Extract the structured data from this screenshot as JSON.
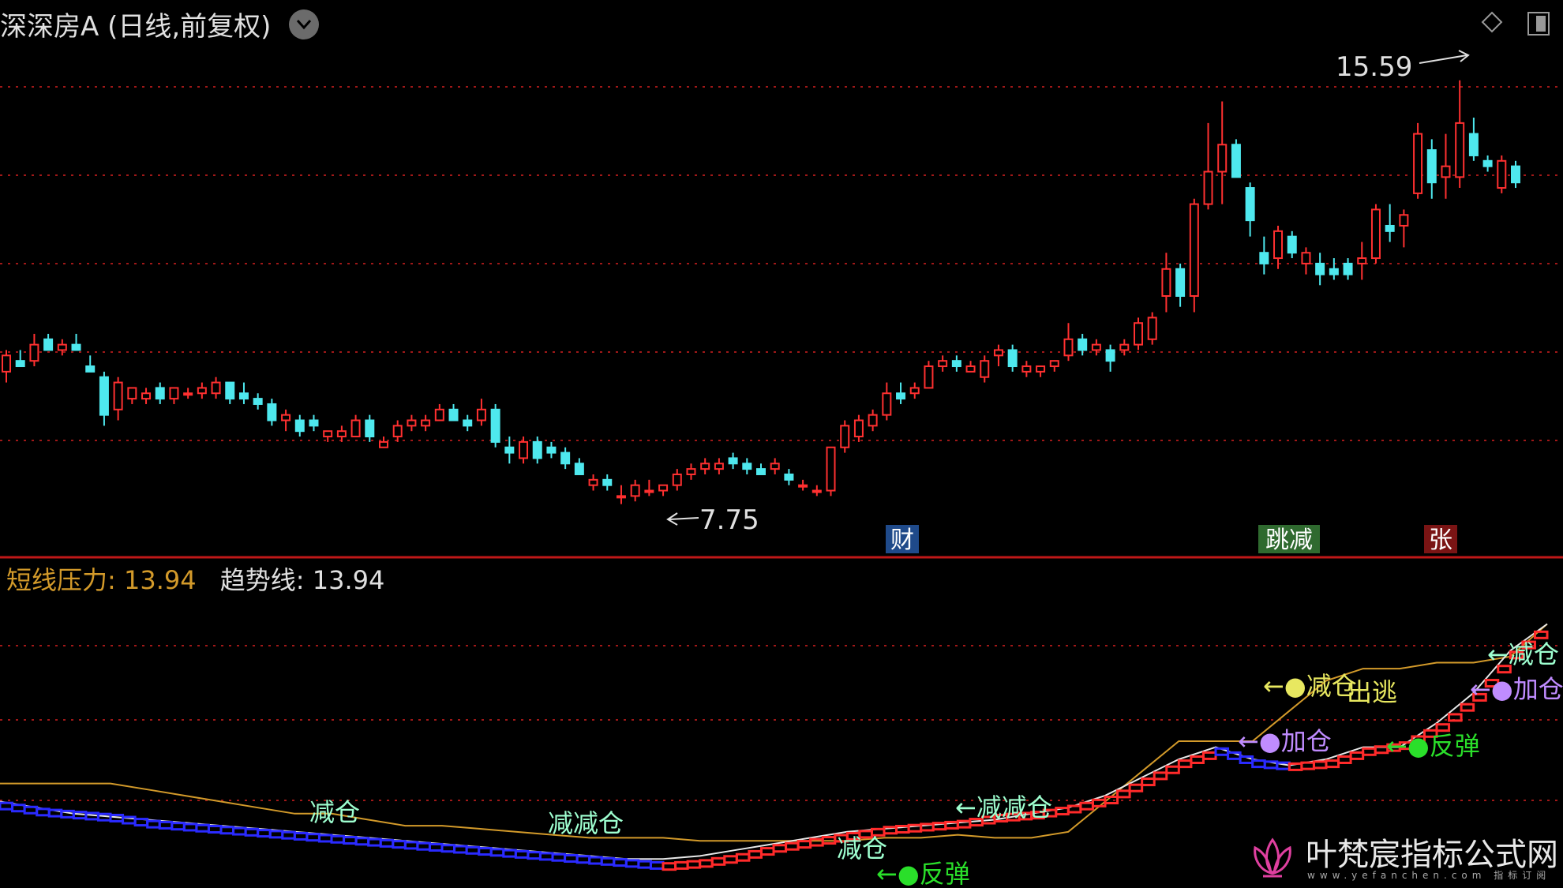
{
  "header": {
    "title": "深深房A (日线,前复权)"
  },
  "markers": {
    "high_label": "15.59",
    "low_label": "7.75",
    "badge_cai": "财",
    "badge_jianjian": "跳减",
    "badge_zhang": "张"
  },
  "legend": {
    "label1": "短线压力:",
    "value1": "13.94",
    "label2": "趋势线:",
    "value2": "13.94"
  },
  "signals": {
    "s1": "减仓",
    "s2": "减减仓",
    "s3": "减仓",
    "s4": "←●反弹",
    "s5": "←减减仓",
    "s6": "←●减仓",
    "s7": "出逃",
    "s8": "←●加仓",
    "s9": "←●反弹",
    "s10": "←减仓",
    "s11": "←●加仓"
  },
  "watermark": {
    "text": "叶梵宸指标公式网",
    "sub": "www.yefanchen.com  指标订阅"
  },
  "colors": {
    "up": "#ff3030",
    "down": "#4ee8ee",
    "grid": "#a01818",
    "orange": "#d39a2a",
    "white_line": "#e8e8e8",
    "blue": "#2a2aff",
    "red_band": "#ff2a2a",
    "green_text": "#2adf2a",
    "yellow_text": "#e8e860",
    "magenta": "#e040e0",
    "violet_text": "#c08cff",
    "cyan_text": "#9effd0"
  },
  "chart_data": [
    {
      "type": "candlestick",
      "ylim": [
        7.0,
        16.2
      ],
      "high_marker": 15.59,
      "low_marker": 7.75,
      "candles": [
        [
          10.2,
          10.6,
          10.0,
          10.5
        ],
        [
          10.4,
          10.6,
          10.3,
          10.3
        ],
        [
          10.4,
          10.9,
          10.3,
          10.7
        ],
        [
          10.8,
          10.9,
          10.6,
          10.6
        ],
        [
          10.6,
          10.8,
          10.5,
          10.7
        ],
        [
          10.7,
          10.9,
          10.6,
          10.6
        ],
        [
          10.3,
          10.5,
          10.2,
          10.2
        ],
        [
          10.1,
          10.2,
          9.2,
          9.4
        ],
        [
          9.5,
          10.1,
          9.3,
          10.0
        ],
        [
          9.7,
          9.9,
          9.6,
          9.9
        ],
        [
          9.7,
          9.9,
          9.6,
          9.8
        ],
        [
          9.9,
          10.0,
          9.6,
          9.7
        ],
        [
          9.7,
          9.9,
          9.6,
          9.9
        ],
        [
          9.8,
          9.9,
          9.7,
          9.8
        ],
        [
          9.8,
          10.0,
          9.7,
          9.9
        ],
        [
          9.8,
          10.1,
          9.7,
          10.0
        ],
        [
          10.0,
          10.0,
          9.6,
          9.7
        ],
        [
          9.8,
          10.0,
          9.6,
          9.7
        ],
        [
          9.7,
          9.8,
          9.5,
          9.6
        ],
        [
          9.6,
          9.7,
          9.2,
          9.3
        ],
        [
          9.3,
          9.5,
          9.1,
          9.4
        ],
        [
          9.3,
          9.4,
          9.0,
          9.1
        ],
        [
          9.3,
          9.4,
          9.1,
          9.2
        ],
        [
          9.0,
          9.1,
          8.9,
          9.1
        ],
        [
          9.0,
          9.2,
          8.9,
          9.1
        ],
        [
          9.0,
          9.4,
          9.0,
          9.3
        ],
        [
          9.3,
          9.4,
          8.9,
          9.0
        ],
        [
          8.8,
          9.0,
          8.8,
          8.9
        ],
        [
          9.0,
          9.3,
          8.9,
          9.2
        ],
        [
          9.2,
          9.4,
          9.1,
          9.3
        ],
        [
          9.2,
          9.4,
          9.1,
          9.3
        ],
        [
          9.3,
          9.6,
          9.3,
          9.5
        ],
        [
          9.5,
          9.6,
          9.3,
          9.3
        ],
        [
          9.3,
          9.4,
          9.1,
          9.2
        ],
        [
          9.3,
          9.7,
          9.2,
          9.5
        ],
        [
          9.5,
          9.6,
          8.8,
          8.9
        ],
        [
          8.8,
          9.0,
          8.5,
          8.7
        ],
        [
          8.6,
          9.0,
          8.5,
          8.9
        ],
        [
          8.9,
          9.0,
          8.5,
          8.6
        ],
        [
          8.8,
          8.9,
          8.6,
          8.7
        ],
        [
          8.7,
          8.8,
          8.4,
          8.5
        ],
        [
          8.5,
          8.6,
          8.3,
          8.3
        ],
        [
          8.1,
          8.3,
          8.0,
          8.2
        ],
        [
          8.2,
          8.3,
          8.0,
          8.1
        ],
        [
          7.9,
          8.1,
          7.75,
          7.9
        ],
        [
          7.9,
          8.2,
          7.8,
          8.1
        ],
        [
          8.0,
          8.2,
          7.9,
          8.0
        ],
        [
          8.0,
          8.1,
          7.9,
          8.1
        ],
        [
          8.1,
          8.4,
          8.0,
          8.3
        ],
        [
          8.3,
          8.5,
          8.2,
          8.4
        ],
        [
          8.4,
          8.6,
          8.3,
          8.5
        ],
        [
          8.4,
          8.6,
          8.3,
          8.5
        ],
        [
          8.6,
          8.7,
          8.4,
          8.5
        ],
        [
          8.5,
          8.6,
          8.3,
          8.4
        ],
        [
          8.4,
          8.5,
          8.3,
          8.3
        ],
        [
          8.4,
          8.6,
          8.3,
          8.5
        ],
        [
          8.3,
          8.4,
          8.1,
          8.2
        ],
        [
          8.1,
          8.2,
          8.0,
          8.1
        ],
        [
          8.0,
          8.1,
          7.9,
          8.0
        ],
        [
          8.0,
          8.8,
          7.9,
          8.8
        ],
        [
          8.8,
          9.3,
          8.7,
          9.2
        ],
        [
          9.0,
          9.4,
          8.9,
          9.3
        ],
        [
          9.2,
          9.5,
          9.1,
          9.4
        ],
        [
          9.4,
          10.0,
          9.3,
          9.8
        ],
        [
          9.8,
          10.0,
          9.6,
          9.7
        ],
        [
          9.8,
          10.0,
          9.7,
          9.9
        ],
        [
          9.9,
          10.4,
          9.9,
          10.3
        ],
        [
          10.3,
          10.5,
          10.2,
          10.4
        ],
        [
          10.4,
          10.5,
          10.2,
          10.3
        ],
        [
          10.2,
          10.4,
          10.2,
          10.3
        ],
        [
          10.1,
          10.5,
          10.0,
          10.4
        ],
        [
          10.5,
          10.7,
          10.3,
          10.6
        ],
        [
          10.6,
          10.7,
          10.2,
          10.3
        ],
        [
          10.2,
          10.4,
          10.1,
          10.3
        ],
        [
          10.2,
          10.3,
          10.1,
          10.3
        ],
        [
          10.3,
          10.4,
          10.2,
          10.4
        ],
        [
          10.5,
          11.1,
          10.4,
          10.8
        ],
        [
          10.8,
          10.9,
          10.5,
          10.6
        ],
        [
          10.6,
          10.8,
          10.5,
          10.7
        ],
        [
          10.6,
          10.7,
          10.2,
          10.4
        ],
        [
          10.6,
          10.8,
          10.5,
          10.7
        ],
        [
          10.7,
          11.2,
          10.6,
          11.1
        ],
        [
          10.8,
          11.3,
          10.7,
          11.2
        ],
        [
          11.6,
          12.4,
          11.3,
          12.1
        ],
        [
          12.1,
          12.2,
          11.4,
          11.6
        ],
        [
          11.6,
          13.4,
          11.3,
          13.3
        ],
        [
          13.3,
          14.8,
          13.2,
          13.9
        ],
        [
          13.9,
          15.2,
          13.3,
          14.4
        ],
        [
          14.4,
          14.5,
          13.8,
          13.8
        ],
        [
          13.6,
          13.7,
          12.7,
          13.0
        ],
        [
          12.4,
          12.7,
          12.0,
          12.2
        ],
        [
          12.3,
          12.9,
          12.1,
          12.8
        ],
        [
          12.7,
          12.8,
          12.3,
          12.4
        ],
        [
          12.2,
          12.5,
          12.0,
          12.4
        ],
        [
          12.2,
          12.4,
          11.8,
          12.0
        ],
        [
          12.1,
          12.3,
          11.9,
          12.0
        ],
        [
          12.2,
          12.3,
          11.9,
          12.0
        ],
        [
          12.2,
          12.6,
          11.9,
          12.3
        ],
        [
          12.3,
          13.3,
          12.2,
          13.2
        ],
        [
          12.9,
          13.3,
          12.6,
          12.8
        ],
        [
          12.9,
          13.2,
          12.5,
          13.1
        ],
        [
          13.5,
          14.8,
          13.4,
          14.6
        ],
        [
          14.3,
          14.5,
          13.4,
          13.7
        ],
        [
          13.8,
          14.6,
          13.4,
          14.0
        ],
        [
          13.8,
          15.59,
          13.6,
          14.8
        ],
        [
          14.6,
          14.9,
          14.1,
          14.2
        ],
        [
          14.1,
          14.2,
          13.9,
          14.0
        ],
        [
          13.6,
          14.2,
          13.5,
          14.1
        ],
        [
          14.0,
          14.1,
          13.6,
          13.7
        ]
      ]
    },
    {
      "type": "line",
      "series": [
        {
          "color_key": "orange",
          "values": [
            11.3,
            11.3,
            11.3,
            11.3,
            11.2,
            11.1,
            11.0,
            10.9,
            10.8,
            10.8,
            10.7,
            10.6,
            10.6,
            10.55,
            10.5,
            10.45,
            10.4,
            10.4,
            10.4,
            10.35,
            10.35,
            10.35,
            10.35,
            10.35,
            10.4,
            10.4,
            10.45,
            10.4,
            10.4,
            10.5,
            11.0,
            11.5,
            12.0,
            12.0,
            12.0,
            12.5,
            13.0,
            13.2,
            13.2,
            13.3,
            13.3,
            13.4,
            13.94
          ]
        },
        {
          "color_key": "white_line",
          "values": [
            11.0,
            10.9,
            10.8,
            10.75,
            10.7,
            10.65,
            10.6,
            10.55,
            10.5,
            10.45,
            10.4,
            10.35,
            10.3,
            10.25,
            10.2,
            10.15,
            10.1,
            10.05,
            10.05,
            10.1,
            10.2,
            10.3,
            10.4,
            10.5,
            10.55,
            10.6,
            10.65,
            10.7,
            10.8,
            10.9,
            11.1,
            11.4,
            11.7,
            11.9,
            11.7,
            11.6,
            11.7,
            11.9,
            11.9,
            12.3,
            12.8,
            13.5,
            13.94
          ]
        },
        {
          "color_key": "blue",
          "values": [
            10.9,
            10.8,
            10.75,
            10.7,
            10.6,
            10.55,
            10.5,
            10.45,
            10.4,
            10.35,
            10.3,
            10.25,
            10.2,
            10.15,
            10.1,
            10.05,
            10.0,
            9.95,
            9.9,
            9.95,
            10.05,
            10.2,
            10.3,
            10.4,
            10.5,
            10.55,
            10.6,
            10.7,
            10.75,
            10.85,
            11.0,
            11.3,
            11.6,
            11.8,
            11.6,
            11.55,
            11.6,
            11.8,
            11.9,
            12.2,
            12.7,
            13.4,
            13.9
          ]
        }
      ]
    }
  ]
}
